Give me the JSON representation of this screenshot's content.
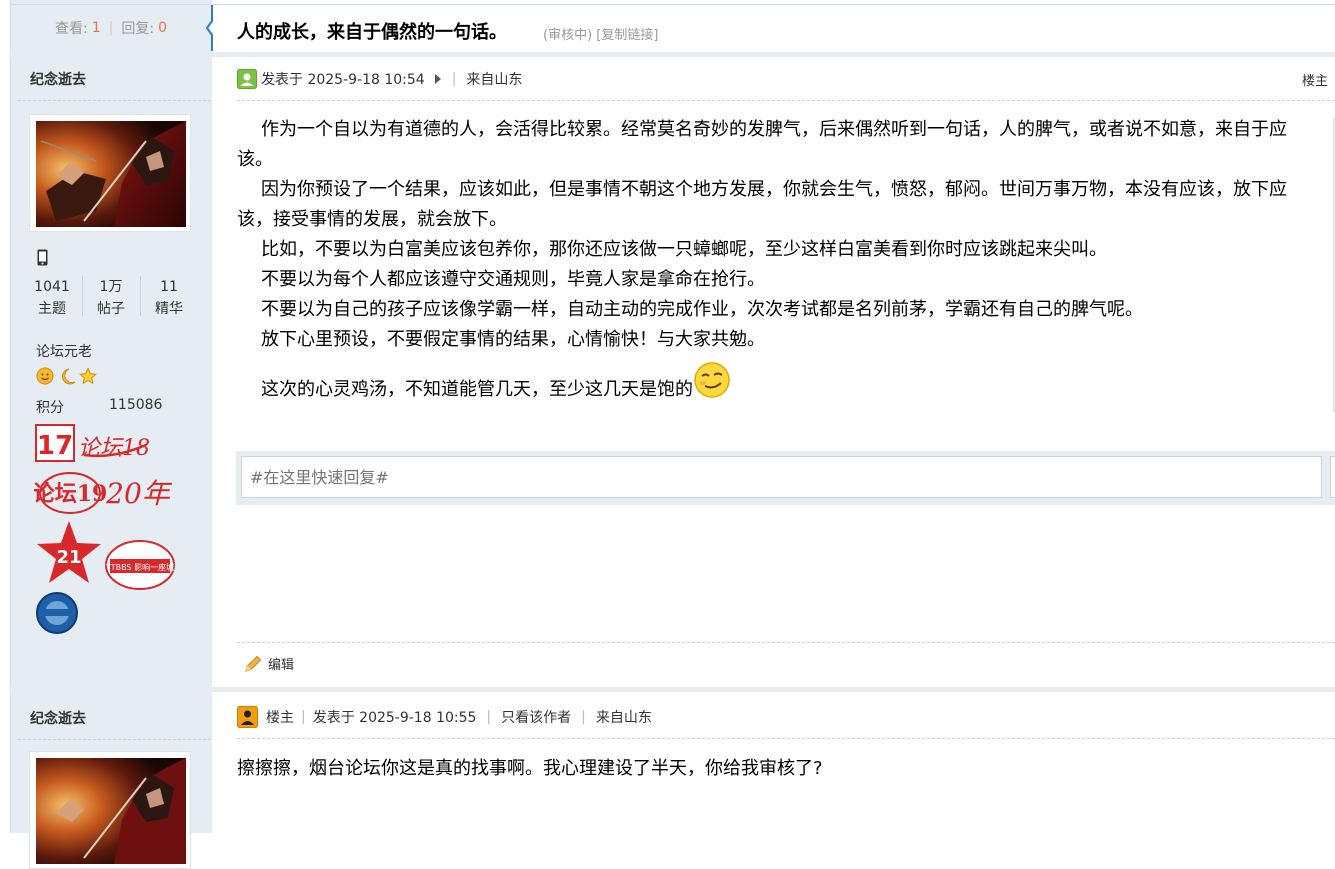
{
  "header": {
    "views_label": "查看:",
    "views_value": "1",
    "replies_label": "回复:",
    "replies_value": "0",
    "title": "人的成长，来自于偶然的一句话。",
    "status": "(审核中)",
    "copy_link": "[复制链接]"
  },
  "posts": [
    {
      "author": {
        "name": "纪念逝去",
        "stats": [
          {
            "value": "1041",
            "label": "主题"
          },
          {
            "value": "1万",
            "label": "帖子"
          },
          {
            "value": "11",
            "label": "精华"
          }
        ],
        "rank": "论坛元老",
        "score_label": "积分",
        "score_value": "115086",
        "medal_texts": [
          "17",
          "论坛18",
          "论坛19",
          "20年",
          "21",
          "YTBBS 影响一座城"
        ]
      },
      "posted": "发表于 2025-9-18 10:54",
      "from": "来自山东",
      "floor": "楼主",
      "paragraphs": [
        "作为一个自以为有道德的人，会活得比较累。经常莫名奇妙的发脾气，后来偶然听到一句话，人的脾气，或者说不如意，来自于应该。",
        "因为你预设了一个结果，应该如此，但是事情不朝这个地方发展，你就会生气，愤怒，郁闷。世间万事万物，本没有应该，放下应该，接受事情的发展，就会放下。",
        "比如，不要以为白富美应该包养你，那你还应该做一只蟑螂呢，至少这样白富美看到你时应该跳起来尖叫。",
        "不要以为每个人都应该遵守交通规则，毕竟人家是拿命在抢行。",
        "不要以为自己的孩子应该像学霸一样，自动主动的完成作业，次次考试都是名列前茅，学霸还有自己的脾气呢。",
        "放下心里预设，不要假定事情的结果，心情愉快！与大家共勉。",
        "这次的心灵鸡汤，不知道能管几天，至少这几天是饱的"
      ],
      "quick_reply_placeholder": "#在这里快速回复#",
      "edit_label": "编辑"
    },
    {
      "author": {
        "name": "纪念逝去"
      },
      "floor_badge": "楼主",
      "posted": "发表于 2025-9-18 10:55",
      "only_author": "只看该作者",
      "from": "来自山东",
      "text": "擦擦擦，烟台论坛你这是真的找事啊。我心理建设了半天，你给我审核了?"
    }
  ],
  "colors": {
    "sidebar_bg": "#e5edf2",
    "accent_blue": "#2b7acd",
    "count_red": "#f26c4f",
    "online_green": "#7cc242",
    "louzhu_orange": "#f39c12"
  }
}
